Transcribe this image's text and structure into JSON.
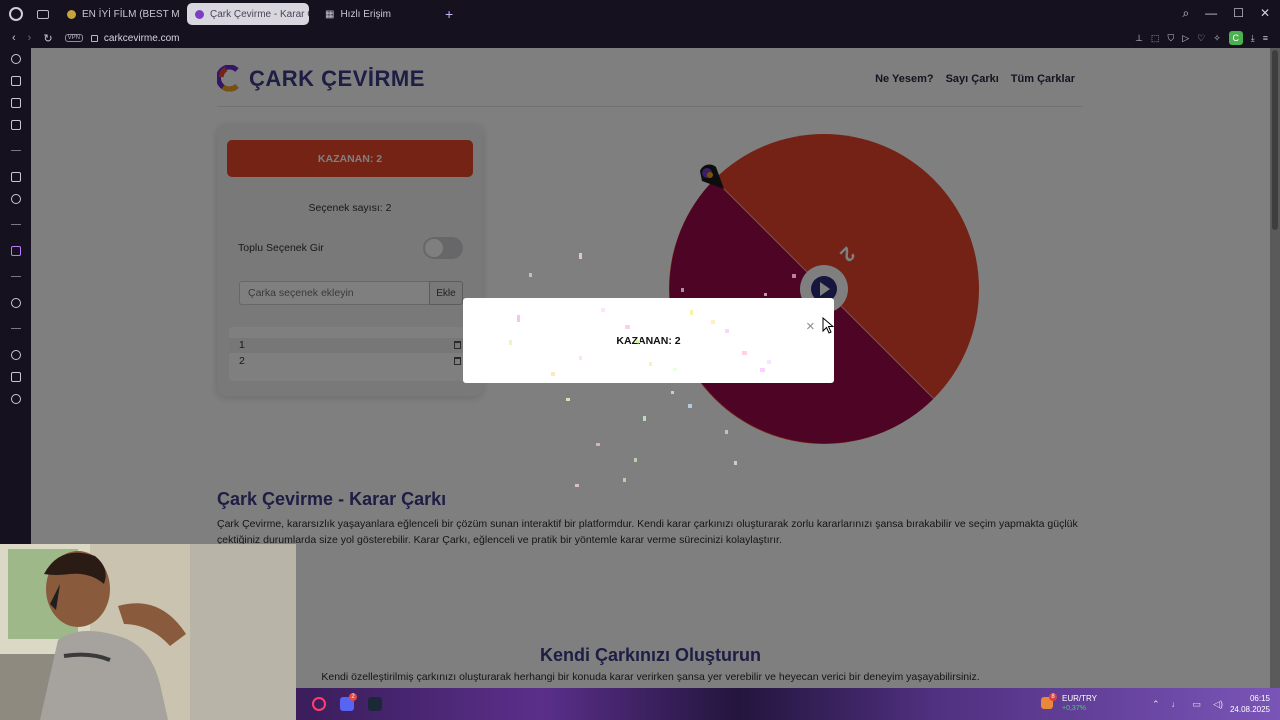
{
  "browser": {
    "tabs": [
      {
        "label": "EN İYİ FİLM (BEST MOVIE",
        "active": false
      },
      {
        "label": "Çark Çevirme - Karar Ça",
        "active": true
      },
      {
        "label": "Hızlı Erişim",
        "active": false
      }
    ],
    "new_tab": "+",
    "url": "carkcevirme.com",
    "vpn": "VPN"
  },
  "site": {
    "logo_text": "ÇARK ÇEVİRME",
    "nav": [
      "Ne Yesem?",
      "Sayı Çarkı",
      "Tüm Çarklar"
    ]
  },
  "panel": {
    "winner_button": "KAZANAN: 2",
    "option_count": "Seçenek sayısı: 2",
    "bulk_label": "Toplu Seçenek Gir",
    "bulk_enabled": false,
    "input_placeholder": "Çarka seçenek ekleyin",
    "add_button": "Ekle",
    "options": [
      "1",
      "2"
    ]
  },
  "wheel": {
    "segments": [
      {
        "label": "1",
        "color": "#9c0a4a"
      },
      {
        "label": "2",
        "color": "#e8452a"
      }
    ],
    "visible_label": "2"
  },
  "modal": {
    "text": "KAZANAN: 2",
    "close": "×"
  },
  "content": {
    "heading1": "Çark Çevirme - Karar Çarkı",
    "paragraph1": "Çark Çevirme, kararsızlık yaşayanlara eğlenceli bir çözüm sunan interaktif bir platformdur. Kendi karar çarkınızı oluşturarak zorlu kararlarınızı şansa bırakabilir ve seçim yapmakta güçlük çektiğiniz durumlarda size yol gösterebilir. Karar Çarkı, eğlenceli ve pratik bir yöntemle karar verme sürecinizi kolaylaştırır.",
    "heading2": "Kendi Çarkınızı Oluşturun",
    "paragraph2": "Kendi özelleştirilmiş çarkınızı oluşturarak herhangi bir konuda karar verirken şansa yer verebilir ve heyecan verici bir deneyim yaşayabilirsiniz."
  },
  "taskbar": {
    "discord_badge": "2",
    "fx_badge": "8",
    "fx_label": "EUR/TRY",
    "fx_change": "+0,37%",
    "time": "06:15",
    "date": "24.08.2025"
  },
  "colors": {
    "accent": "#e8462a",
    "brand": "#3d3a88",
    "wheel_red": "#e8452a",
    "wheel_crimson": "#9c0a4a"
  }
}
